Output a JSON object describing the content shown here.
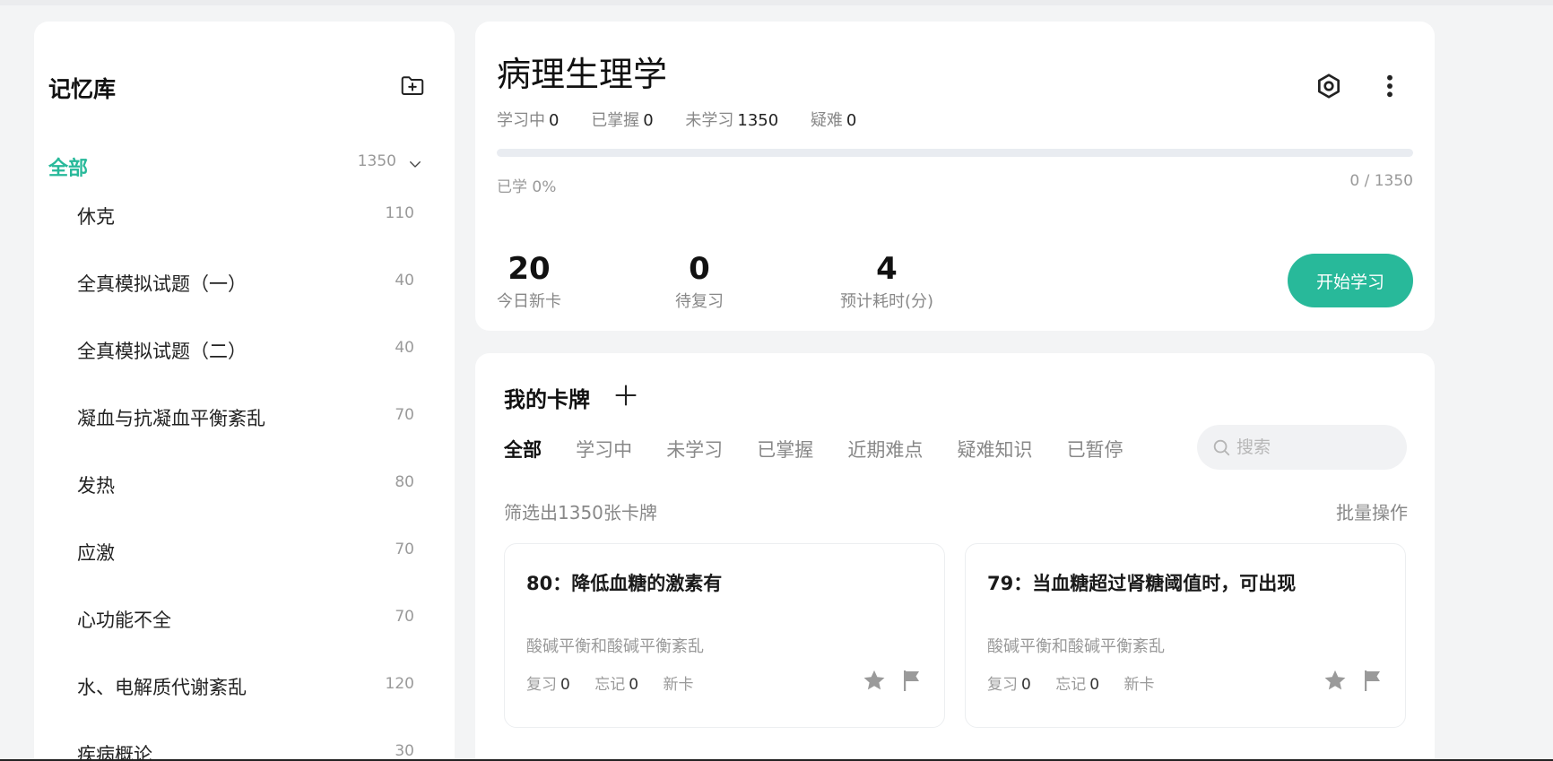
{
  "sidebar": {
    "title": "记忆库",
    "all": {
      "label": "全部",
      "count": "1350"
    },
    "items": [
      {
        "label": "休克",
        "count": "110"
      },
      {
        "label": "全真模拟试题（一）",
        "count": "40"
      },
      {
        "label": "全真模拟试题（二）",
        "count": "40"
      },
      {
        "label": "凝血与抗凝血平衡紊乱",
        "count": "70"
      },
      {
        "label": "发热",
        "count": "80"
      },
      {
        "label": "应激",
        "count": "70"
      },
      {
        "label": "心功能不全",
        "count": "70"
      },
      {
        "label": "水、电解质代谢紊乱",
        "count": "120"
      },
      {
        "label": "疾病概论",
        "count": "30"
      }
    ]
  },
  "header": {
    "title": "病理生理学",
    "stats": [
      {
        "label": "学习中",
        "value": "0"
      },
      {
        "label": "已掌握",
        "value": "0"
      },
      {
        "label": "未学习",
        "value": "1350"
      },
      {
        "label": "疑难",
        "value": "0"
      }
    ],
    "progress_fraction": 0,
    "progress_label": "已学 0%",
    "progress_count": "0 / 1350",
    "metrics": [
      {
        "value": "20",
        "label": "今日新卡"
      },
      {
        "value": "0",
        "label": "待复习"
      },
      {
        "value": "4",
        "label": "预计耗时(分)"
      }
    ],
    "start_label": "开始学习"
  },
  "cards_section": {
    "title": "我的卡牌",
    "tabs": [
      "全部",
      "学习中",
      "未学习",
      "已掌握",
      "近期难点",
      "疑难知识",
      "已暂停"
    ],
    "active_tab": "全部",
    "search_placeholder": "搜索",
    "filter_text": "筛选出1350张卡牌",
    "batch_label": "批量操作",
    "cards": [
      {
        "title": "80：降低血糖的激素有",
        "subtitle": "酸碱平衡和酸碱平衡紊乱",
        "review_label": "复习",
        "review": "0",
        "forget_label": "忘记",
        "forget": "0",
        "status": "新卡"
      },
      {
        "title": "79：当血糖超过肾糖阈值时，可出现",
        "subtitle": "酸碱平衡和酸碱平衡紊乱",
        "review_label": "复习",
        "review": "0",
        "forget_label": "忘记",
        "forget": "0",
        "status": "新卡"
      }
    ]
  },
  "icons": {
    "add_folder": "folder-plus-icon",
    "chevron": "chevron-down-icon",
    "target": "target-icon",
    "more": "more-vertical-icon",
    "plus": "plus-icon",
    "search": "search-icon",
    "star": "star-icon",
    "flag": "flag-icon"
  },
  "colors": {
    "accent": "#28b99a",
    "icon_gray": "#999999"
  }
}
